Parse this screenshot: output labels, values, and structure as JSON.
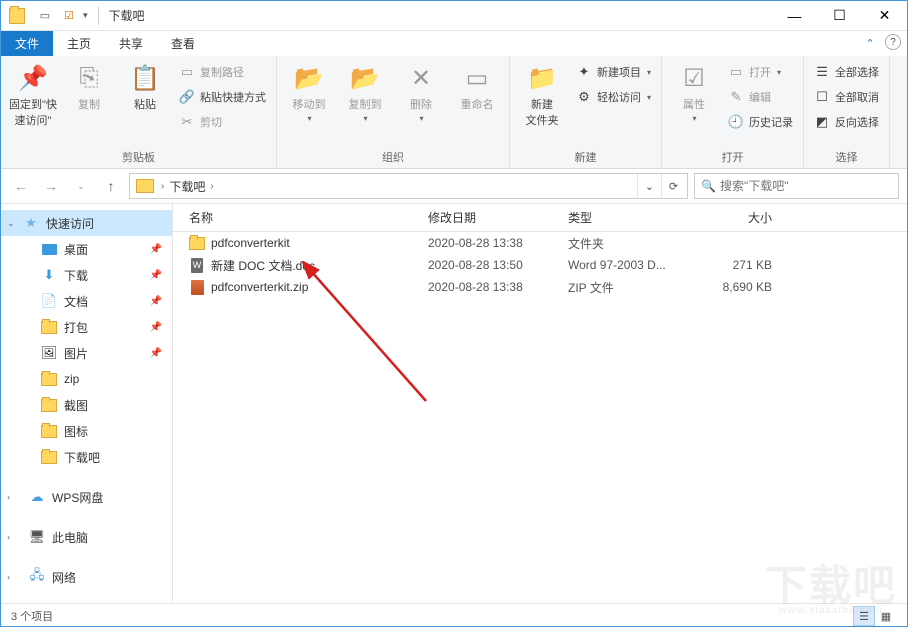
{
  "titlebar": {
    "title": "下载吧"
  },
  "tabs": {
    "file": "文件",
    "home": "主页",
    "share": "共享",
    "view": "查看"
  },
  "ribbon": {
    "pin": "固定到\"快\n速访问\"",
    "copy": "复制",
    "paste": "粘贴",
    "copypath": "复制路径",
    "pasteshortcut": "粘贴快捷方式",
    "cut": "剪切",
    "clipboard": "剪贴板",
    "moveto": "移动到",
    "copyto": "复制到",
    "delete": "删除",
    "rename": "重命名",
    "organize": "组织",
    "newfolder": "新建\n文件夹",
    "newitem": "新建项目",
    "easyaccess": "轻松访问",
    "new": "新建",
    "properties": "属性",
    "open": "打开",
    "edit": "编辑",
    "history": "历史记录",
    "open_group": "打开",
    "selectall": "全部选择",
    "selectnone": "全部取消",
    "invertsel": "反向选择",
    "select": "选择"
  },
  "addr": {
    "crumb1": "下载吧",
    "refresh": "⟳",
    "dropdown": "⌄"
  },
  "search": {
    "placeholder": "搜索\"下载吧\""
  },
  "sidebar": {
    "quick": "快速访问",
    "desktop": "桌面",
    "downloads": "下载",
    "documents": "文档",
    "dabao": "打包",
    "pictures": "图片",
    "zip": "zip",
    "jietu": "截图",
    "tubiao": "图标",
    "xiazaiba": "下载吧",
    "wps": "WPS网盘",
    "thispc": "此电脑",
    "network": "网络"
  },
  "columns": {
    "name": "名称",
    "date": "修改日期",
    "type": "类型",
    "size": "大小"
  },
  "files": [
    {
      "icon": "folder",
      "name": "pdfconverterkit",
      "date": "2020-08-28 13:38",
      "type": "文件夹",
      "size": ""
    },
    {
      "icon": "doc",
      "name": "新建 DOC 文档.doc",
      "date": "2020-08-28 13:50",
      "type": "Word 97-2003 D...",
      "size": "271 KB"
    },
    {
      "icon": "zip",
      "name": "pdfconverterkit.zip",
      "date": "2020-08-28 13:38",
      "type": "ZIP 文件",
      "size": "8,690 KB"
    }
  ],
  "status": {
    "count": "3 个项目"
  }
}
